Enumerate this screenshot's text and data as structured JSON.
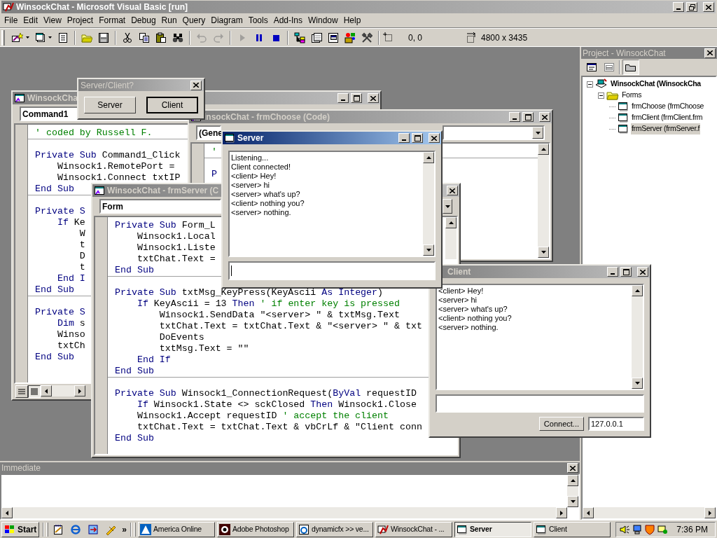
{
  "app_window": {
    "title": "WinsockChat - Microsoft Visual Basic [run]"
  },
  "menu": [
    "File",
    "Edit",
    "View",
    "Project",
    "Format",
    "Debug",
    "Run",
    "Query",
    "Diagram",
    "Tools",
    "Add-Ins",
    "Window",
    "Help"
  ],
  "toolbar": {
    "groups": [
      [
        {
          "kind": "add-project",
          "disabled": false
        },
        {
          "kind": "add-form",
          "disabled": false
        },
        {
          "kind": "menu-editor",
          "disabled": false
        }
      ],
      [
        {
          "kind": "open",
          "disabled": false
        },
        {
          "kind": "save",
          "disabled": false
        }
      ],
      [
        {
          "kind": "cut",
          "disabled": false
        },
        {
          "kind": "copy",
          "disabled": false
        },
        {
          "kind": "paste",
          "disabled": false
        },
        {
          "kind": "find",
          "disabled": false
        }
      ],
      [
        {
          "kind": "undo",
          "disabled": true
        },
        {
          "kind": "redo",
          "disabled": true
        }
      ],
      [
        {
          "kind": "start",
          "disabled": true
        },
        {
          "kind": "pause",
          "disabled": false
        },
        {
          "kind": "stop",
          "disabled": false
        }
      ],
      [
        {
          "kind": "project-explorer",
          "disabled": false
        },
        {
          "kind": "properties",
          "disabled": false
        },
        {
          "kind": "form-layout",
          "disabled": false
        },
        {
          "kind": "object-browser",
          "disabled": false
        },
        {
          "kind": "toolbox",
          "disabled": false
        }
      ]
    ],
    "position": "0, 0",
    "size": "4800 x 3435"
  },
  "code_windows": [
    {
      "title": "WinsockCha",
      "object": "Command1",
      "procedures": [
        [
          [
            {
              "kind": "comment",
              "text": "' coded by Russell F."
            }
          ]
        ],
        [
          [
            {
              "kind": "keyword",
              "text": "Private Sub"
            },
            {
              "kind": "plain",
              "text": " Command1_Click"
            }
          ],
          [
            {
              "kind": "plain",
              "text": "    Winsock1.RemotePort ="
            }
          ],
          [
            {
              "kind": "plain",
              "text": "    Winsock1.Connect txtIP"
            }
          ],
          [
            {
              "kind": "keyword",
              "text": "End Sub"
            }
          ]
        ],
        [
          [
            {
              "kind": "keyword",
              "text": "Private S"
            }
          ],
          [
            {
              "kind": "keyword",
              "text": "    If"
            },
            {
              "kind": "plain",
              "text": " Ke"
            }
          ],
          [
            {
              "kind": "plain",
              "text": "        W"
            }
          ],
          [
            {
              "kind": "plain",
              "text": "        t"
            }
          ],
          [
            {
              "kind": "plain",
              "text": "        D"
            }
          ],
          [
            {
              "kind": "plain",
              "text": "        t"
            }
          ],
          [
            {
              "kind": "keyword",
              "text": "    End I"
            }
          ],
          [
            {
              "kind": "keyword",
              "text": "End Sub"
            }
          ]
        ],
        [
          [
            {
              "kind": "keyword",
              "text": "Private S"
            }
          ],
          [
            {
              "kind": "keyword",
              "text": "    Dim"
            },
            {
              "kind": "plain",
              "text": " s"
            }
          ],
          [
            {
              "kind": "plain",
              "text": "    Winso"
            }
          ],
          [
            {
              "kind": "plain",
              "text": "    txtCh"
            }
          ],
          [
            {
              "kind": "keyword",
              "text": "End Sub"
            }
          ]
        ]
      ]
    },
    {
      "title": "insockChat - frmChoose (Code)",
      "object": "(Gene",
      "procedures": [
        [
          [
            {
              "kind": "comment",
              "text": "'"
            }
          ]
        ],
        [
          [
            {
              "kind": "keyword",
              "text": "P"
            }
          ]
        ]
      ]
    },
    {
      "title": "WinsockChat - frmServer (C",
      "object": "Form",
      "procedures": [
        [
          [
            {
              "kind": "keyword",
              "text": "Private Sub"
            },
            {
              "kind": "plain",
              "text": " Form_L"
            }
          ],
          [
            {
              "kind": "plain",
              "text": "    Winsock1.Local"
            }
          ],
          [
            {
              "kind": "plain",
              "text": "    Winsock1.Liste"
            }
          ],
          [
            {
              "kind": "plain",
              "text": "    txtChat.Text ="
            }
          ],
          [
            {
              "kind": "keyword",
              "text": "End Sub"
            }
          ]
        ],
        [
          [
            {
              "kind": "keyword",
              "text": "Private Sub"
            },
            {
              "kind": "plain",
              "text": " txtMsg_KeyPress(KeyAscii "
            },
            {
              "kind": "keyword",
              "text": "As Integer"
            },
            {
              "kind": "plain",
              "text": ")"
            }
          ],
          [
            {
              "kind": "keyword",
              "text": "    If"
            },
            {
              "kind": "plain",
              "text": " KeyAscii = 13 "
            },
            {
              "kind": "keyword",
              "text": "Then"
            },
            {
              "kind": "comment",
              "text": " ' if enter key is pressed"
            }
          ],
          [
            {
              "kind": "plain",
              "text": "        Winsock1.SendData \"<server> \" & txtMsg.Text"
            }
          ],
          [
            {
              "kind": "plain",
              "text": "        txtChat.Text = txtChat.Text & \"<server> \" & txt"
            }
          ],
          [
            {
              "kind": "plain",
              "text": "        DoEvents"
            }
          ],
          [
            {
              "kind": "plain",
              "text": "        txtMsg.Text = \"\""
            }
          ],
          [
            {
              "kind": "keyword",
              "text": "    End If"
            }
          ],
          [
            {
              "kind": "keyword",
              "text": "End Sub"
            }
          ]
        ],
        [
          [
            {
              "kind": "keyword",
              "text": "Private Sub"
            },
            {
              "kind": "plain",
              "text": " Winsock1_ConnectionRequest("
            },
            {
              "kind": "keyword",
              "text": "ByVal"
            },
            {
              "kind": "plain",
              "text": " requestID"
            }
          ],
          [
            {
              "kind": "keyword",
              "text": "    If"
            },
            {
              "kind": "plain",
              "text": " Winsock1.State <> sckClosed "
            },
            {
              "kind": "keyword",
              "text": "Then"
            },
            {
              "kind": "plain",
              "text": " Winsock1.Close"
            }
          ],
          [
            {
              "kind": "plain",
              "text": "    Winsock1.Accept requestID"
            },
            {
              "kind": "comment",
              "text": " ' accept the client"
            }
          ],
          [
            {
              "kind": "plain",
              "text": "    txtChat.Text = txtChat.Text & vbCrLf & \"Client conn"
            }
          ],
          [
            {
              "kind": "keyword",
              "text": "End Sub"
            }
          ]
        ]
      ]
    }
  ],
  "choose_dialog": {
    "title": "Server/Client?",
    "buttons": [
      {
        "label": "Server",
        "default": false
      },
      {
        "label": "Client",
        "default": true
      }
    ]
  },
  "server_form": {
    "title": "Server",
    "active": true,
    "chat_lines": [
      "Listening...",
      "Client connected!",
      "<client> Hey!",
      "<server> hi",
      "<server> what's up?",
      "<client> nothing you?",
      "<server> nothing."
    ]
  },
  "client_form": {
    "title": "Client",
    "active": false,
    "chat_lines": [
      "<client> Hey!",
      "<server> hi",
      "<server> what's up?",
      "<client> nothing you?",
      "<server> nothing."
    ],
    "connect_button": "Connect...",
    "ip_value": "127.0.0.1"
  },
  "project_explorer": {
    "title": "Project - WinsockChat",
    "tree": [
      {
        "kind": "project",
        "label": "WinsockChat (WinsockCha",
        "expanded": true,
        "selected": false,
        "children": [
          {
            "kind": "folder",
            "label": "Forms",
            "expanded": true,
            "selected": false,
            "children": [
              {
                "kind": "form",
                "label": "frmChoose (frmChoose",
                "selected": false
              },
              {
                "kind": "form",
                "label": "frmClient (frmClient.frm",
                "selected": false
              },
              {
                "kind": "form",
                "label": "frmServer (frmServer.f",
                "selected": true
              }
            ]
          }
        ]
      }
    ]
  },
  "immediate": {
    "title": "Immediate"
  },
  "taskbar": {
    "start": "Start",
    "chevron": "»",
    "tasks": [
      {
        "kind": "aol",
        "label": "America Online",
        "selected": false
      },
      {
        "kind": "photoshop",
        "label": "Adobe Photoshop",
        "selected": false
      },
      {
        "kind": "browser",
        "label": "dynamicfx >> ve...",
        "selected": false
      },
      {
        "kind": "vb",
        "label": "WinsockChat - ...",
        "selected": false
      },
      {
        "kind": "form",
        "label": "Server",
        "selected": true
      },
      {
        "kind": "form",
        "label": "Client",
        "selected": false
      }
    ],
    "clock": "7:36 PM"
  }
}
